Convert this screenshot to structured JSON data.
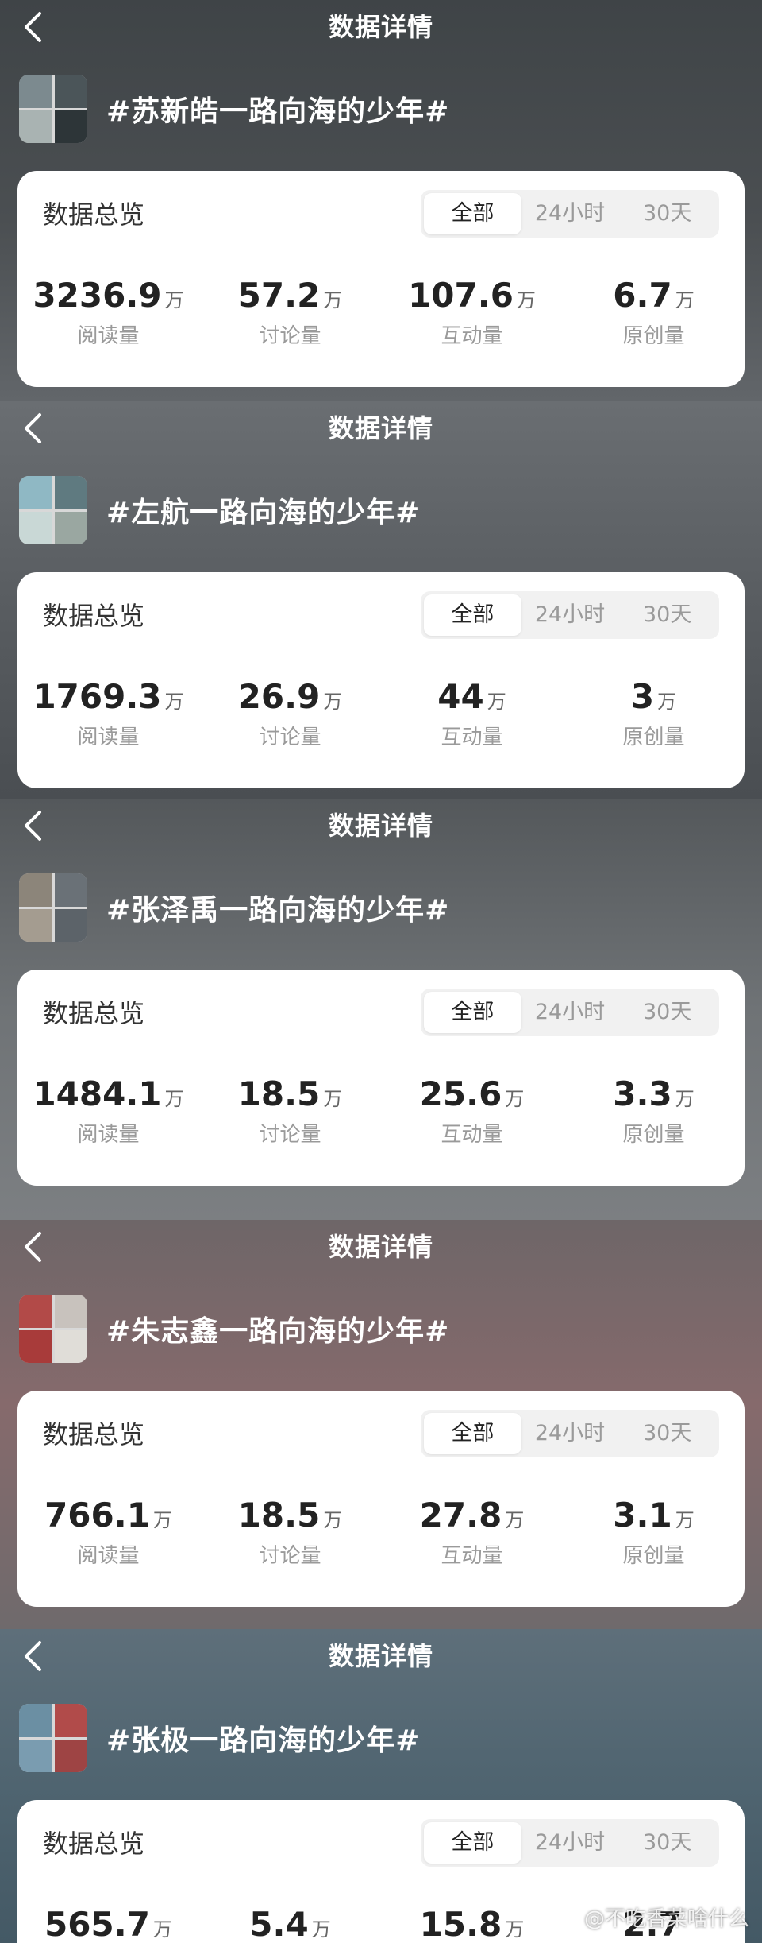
{
  "colors": {
    "card": "#ffffff",
    "tab_bg": "#f1f1f1",
    "number": "#222222",
    "label": "#9a9a9a"
  },
  "sections": [
    {
      "title": "数据详情",
      "topic": "#苏新皓一路向海的少年#",
      "overview_title": "数据总览",
      "tabs": [
        "全部",
        "24小时",
        "30天"
      ],
      "active_tab": "全部",
      "stats": [
        {
          "value": "3236.9",
          "unit": "万",
          "label": "阅读量"
        },
        {
          "value": "57.2",
          "unit": "万",
          "label": "讨论量"
        },
        {
          "value": "107.6",
          "unit": "万",
          "label": "互动量"
        },
        {
          "value": "6.7",
          "unit": "万",
          "label": "原创量"
        }
      ]
    },
    {
      "title": "数据详情",
      "topic": "#左航一路向海的少年#",
      "overview_title": "数据总览",
      "tabs": [
        "全部",
        "24小时",
        "30天"
      ],
      "active_tab": "全部",
      "stats": [
        {
          "value": "1769.3",
          "unit": "万",
          "label": "阅读量"
        },
        {
          "value": "26.9",
          "unit": "万",
          "label": "讨论量"
        },
        {
          "value": "44",
          "unit": "万",
          "label": "互动量"
        },
        {
          "value": "3",
          "unit": "万",
          "label": "原创量"
        }
      ]
    },
    {
      "title": "数据详情",
      "topic": "#张泽禹一路向海的少年#",
      "overview_title": "数据总览",
      "tabs": [
        "全部",
        "24小时",
        "30天"
      ],
      "active_tab": "全部",
      "stats": [
        {
          "value": "1484.1",
          "unit": "万",
          "label": "阅读量"
        },
        {
          "value": "18.5",
          "unit": "万",
          "label": "讨论量"
        },
        {
          "value": "25.6",
          "unit": "万",
          "label": "互动量"
        },
        {
          "value": "3.3",
          "unit": "万",
          "label": "原创量"
        }
      ]
    },
    {
      "title": "数据详情",
      "topic": "#朱志鑫一路向海的少年#",
      "overview_title": "数据总览",
      "tabs": [
        "全部",
        "24小时",
        "30天"
      ],
      "active_tab": "全部",
      "stats": [
        {
          "value": "766.1",
          "unit": "万",
          "label": "阅读量"
        },
        {
          "value": "18.5",
          "unit": "万",
          "label": "讨论量"
        },
        {
          "value": "27.8",
          "unit": "万",
          "label": "互动量"
        },
        {
          "value": "3.1",
          "unit": "万",
          "label": "原创量"
        }
      ]
    },
    {
      "title": "数据详情",
      "topic": "#张极一路向海的少年#",
      "overview_title": "数据总览",
      "tabs": [
        "全部",
        "24小时",
        "30天"
      ],
      "active_tab": "全部",
      "stats": [
        {
          "value": "565.7",
          "unit": "万",
          "label": ""
        },
        {
          "value": "5.4",
          "unit": "万",
          "label": ""
        },
        {
          "value": "15.8",
          "unit": "万",
          "label": ""
        },
        {
          "value": "2.7",
          "unit": "",
          "label": ""
        }
      ]
    }
  ],
  "watermark": "@不吃香菜啥什么"
}
